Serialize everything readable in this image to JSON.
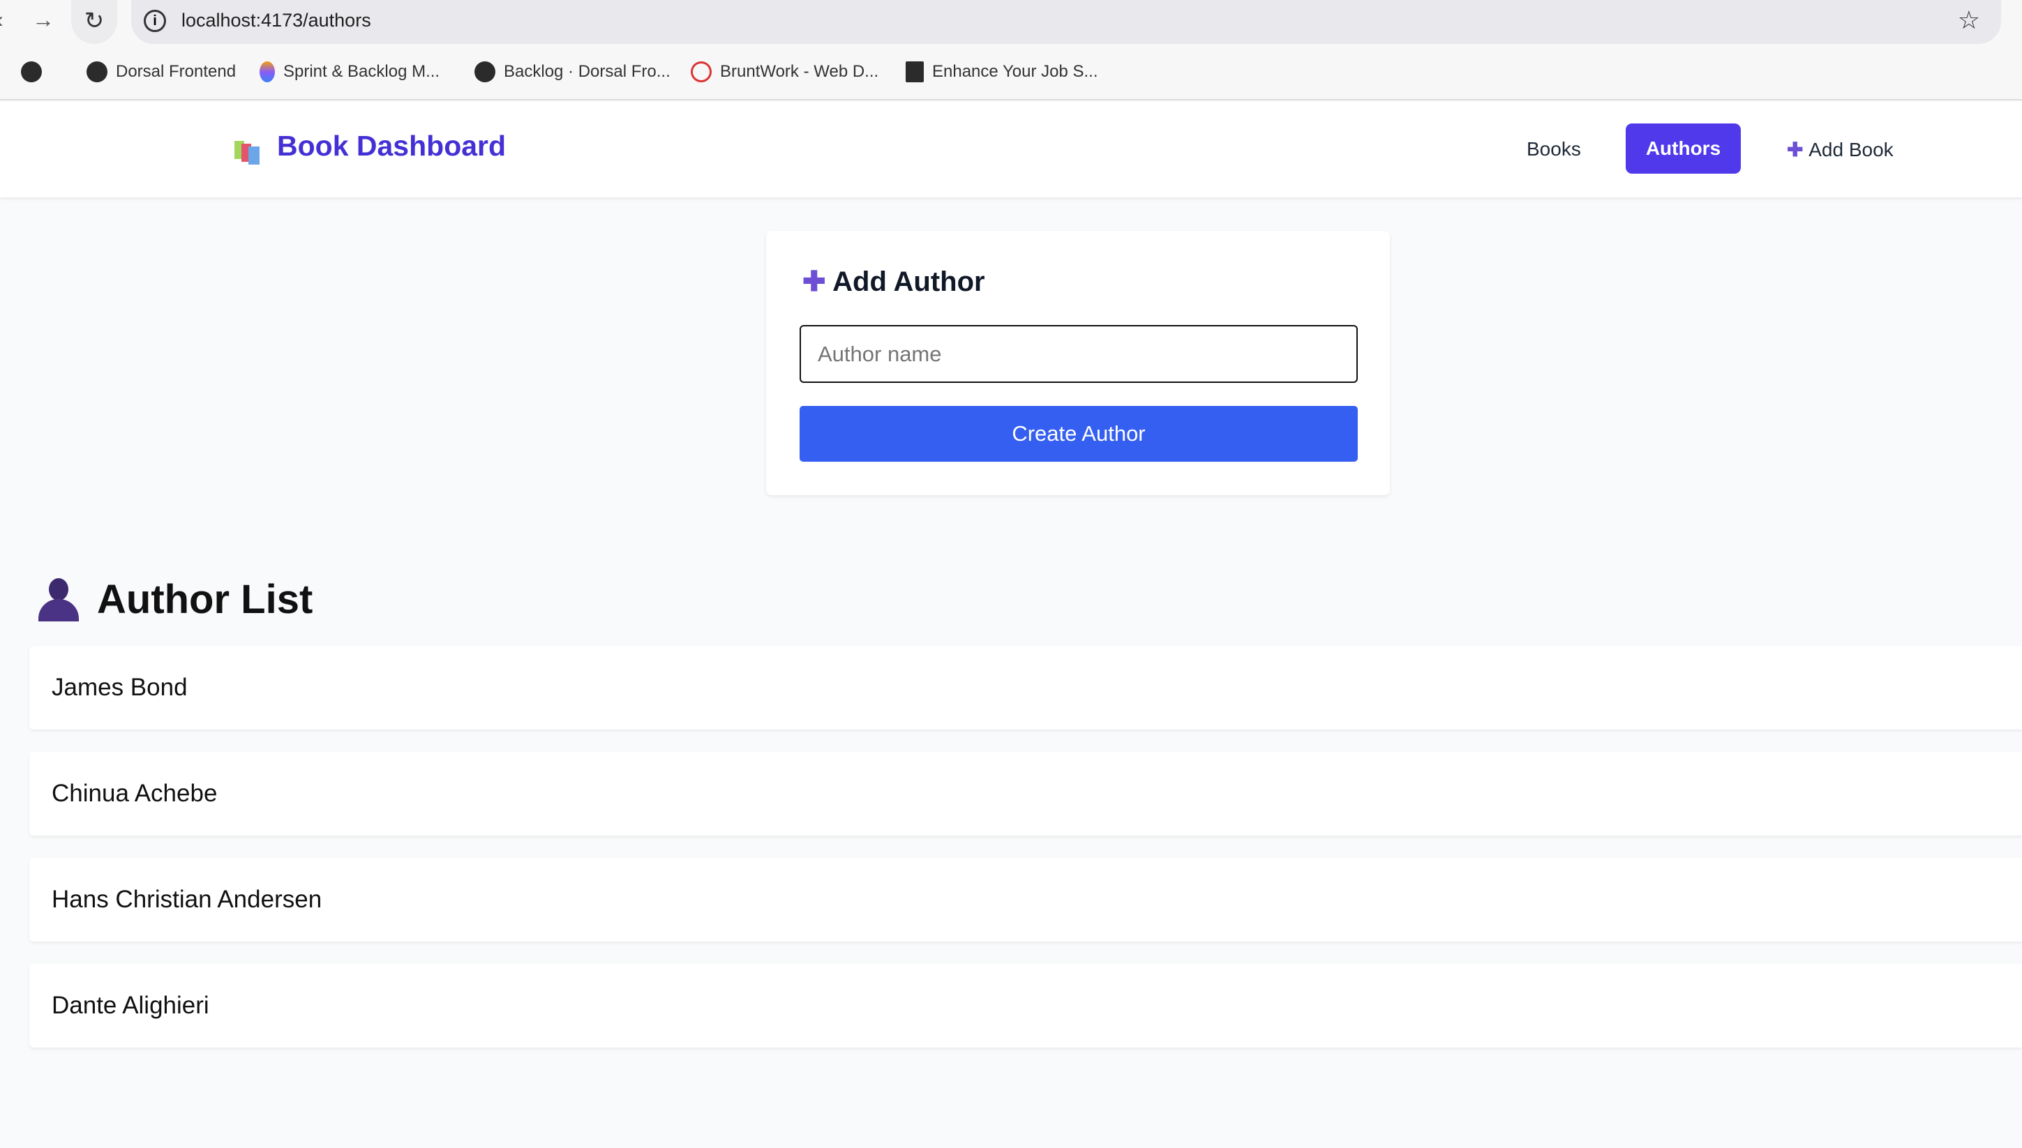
{
  "browser": {
    "url": "localhost:4173/authors",
    "bookmarks": [
      "Dorsal Frontend",
      "Sprint & Backlog M...",
      "Backlog · Dorsal Fro...",
      "BruntWork - Web D...",
      "Enhance Your Job S..."
    ]
  },
  "header": {
    "title": "Book Dashboard",
    "nav": {
      "books": "Books",
      "authors": "Authors",
      "add_book": "Add Book"
    }
  },
  "add_author": {
    "title": "Add Author",
    "placeholder": "Author name",
    "button": "Create Author"
  },
  "author_list": {
    "title": "Author List",
    "authors": [
      "James Bond",
      "Chinua Achebe",
      "Hans Christian Andersen",
      "Dante Alighieri"
    ]
  },
  "colors": {
    "accent": "#4f39ea",
    "primary_button": "#355ff0"
  }
}
